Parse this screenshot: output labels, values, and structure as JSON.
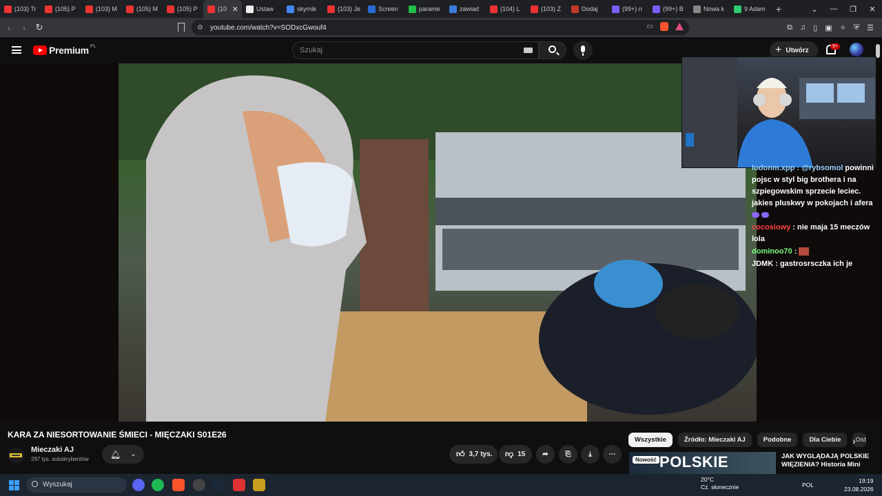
{
  "browser": {
    "tabs": [
      {
        "label": "(103) Tr",
        "fav": "#e33"
      },
      {
        "label": "(105) P",
        "fav": "#e33"
      },
      {
        "label": "(103) M",
        "fav": "#e33"
      },
      {
        "label": "(105) M",
        "fav": "#e33"
      },
      {
        "label": "(105) P",
        "fav": "#e33"
      },
      {
        "label": "(10",
        "fav": "#e33",
        "active": true
      },
      {
        "label": "Ustaw",
        "fav": "#eee"
      },
      {
        "label": "skyrnik",
        "fav": "#4285f4"
      },
      {
        "label": "(103) Je",
        "fav": "#e33"
      },
      {
        "label": "Screen",
        "fav": "#2a6cd6"
      },
      {
        "label": "parame",
        "fav": "#1fbf4a"
      },
      {
        "label": "zawiad",
        "fav": "#3b7ddd"
      },
      {
        "label": "(104) L",
        "fav": "#e33"
      },
      {
        "label": "(103) Z",
        "fav": "#e33"
      },
      {
        "label": "Dodaj",
        "fav": "#c0392b"
      },
      {
        "label": "(99+) n",
        "fav": "#7b5cff"
      },
      {
        "label": "(99+) B",
        "fav": "#7b5cff"
      },
      {
        "label": "Nowa k",
        "fav": "#888"
      },
      {
        "label": "9 Adam",
        "fav": "#2ecc71"
      }
    ],
    "url": "youtube.com/watch?v=SODxcGwouf4"
  },
  "yt": {
    "logo_text": "Premium",
    "logo_country": "PL",
    "search_placeholder": "Szukaj",
    "create_label": "Utwórz",
    "notif_badge": "9+"
  },
  "overlay": {
    "chat": [
      {
        "user": "lodonm.xpp",
        "mention": "@rybsomol",
        "text": "powinni pojsc w styl big brothera i na szpiegowskim sprzecie leciec. jakies pluskwy w pokojach i afera",
        "emotes": 2,
        "cls": "u1"
      },
      {
        "user": "cocosiowy",
        "text": "nie maja 15 meczów lola",
        "cls": "u2"
      },
      {
        "user": "dominoo70",
        "text": "",
        "emote_img": true,
        "cls": "u3"
      },
      {
        "user": "JDMK",
        "text": "gastrosrsczka ich je",
        "cls": "u4"
      }
    ]
  },
  "video": {
    "title": "KARA ZA NIESORTOWANIE ŚMIECI - MIĘCZAKI S01E26",
    "channel": "Mieczaki AJ",
    "subscribers": "297 tys. subskrybentów",
    "likes": "3,7 tys.",
    "dislikes": "15"
  },
  "chips": [
    "Wszystkie",
    "Źródło: Mieczaki AJ",
    "Podobne",
    "Dla Ciebie",
    "Ost"
  ],
  "recommended": {
    "badge": "Nowość",
    "thumb_text": "POLSKIE WIĘZIENIA",
    "title": "JAK WYGLĄDAJĄ POLSKIE WIĘZIENIA? Historia Mini"
  },
  "taskbar": {
    "search_label": "Wyszukaj",
    "weather_temp": "20°C",
    "weather_desc": "Cz. słonecznie",
    "lang": "POL",
    "time": "19:19",
    "date": "23.08.2026"
  }
}
